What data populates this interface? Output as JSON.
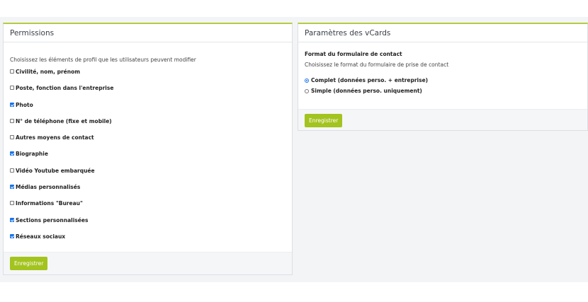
{
  "permissions": {
    "title": "Permissions",
    "intro": "Choisissez les éléments de profil que les utilisateurs peuvent modifier",
    "options": [
      {
        "label": "Civilité, nom, prénom",
        "checked": false
      },
      {
        "label": "Poste, fonction dans l'entreprise",
        "checked": false
      },
      {
        "label": "Photo",
        "checked": true
      },
      {
        "label": "N° de téléphone (fixe et mobile)",
        "checked": false
      },
      {
        "label": "Autres moyens de contact",
        "checked": false
      },
      {
        "label": "Biographie",
        "checked": true
      },
      {
        "label": "Vidéo Youtube embarquée",
        "checked": false
      },
      {
        "label": "Médias personnalisés",
        "checked": true
      },
      {
        "label": "Informations \"Bureau\"",
        "checked": false
      },
      {
        "label": "Sections personnalisées",
        "checked": true
      },
      {
        "label": "Réseaux sociaux",
        "checked": true
      }
    ],
    "save_label": "Enregistrer"
  },
  "vcards": {
    "title": "Paramètres des vCards",
    "section_title": "Format du formulaire de contact",
    "section_sub": "Choisissez le format du formulaire de prise de contact",
    "options": [
      {
        "label": "Complet (données perso. + entreprise)",
        "selected": true
      },
      {
        "label": "Simple (données perso. uniquement)",
        "selected": false
      }
    ],
    "save_label": "Enregistrer"
  },
  "colors": {
    "accent": "#a3c31f",
    "header_border": "#b6cc3f",
    "check": "#1a73e8"
  }
}
